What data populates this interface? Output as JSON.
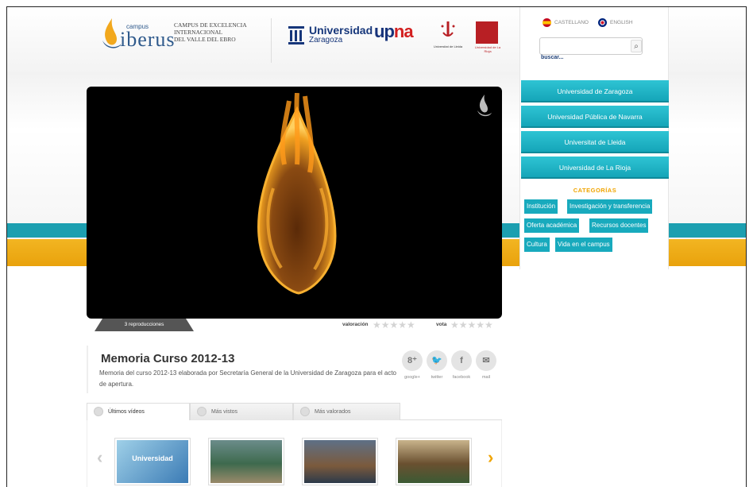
{
  "header": {
    "campus_small": "campus",
    "brand": "iberus",
    "campus_line1": "Campus de Excelencia",
    "campus_line2": "Internacional",
    "campus_line3": "del Valle del Ebro",
    "uz_title": "Universidad",
    "uz_sub": "Zaragoza",
    "upna_main": "up",
    "upna_accent": "na",
    "lleida_caption": "Universitat de Lleida",
    "rioja_caption": "Universidad de La Rioja"
  },
  "sidebar": {
    "lang_es": "Castellano",
    "lang_en": "English",
    "search_value": "",
    "search_label": "buscar...",
    "universities": [
      "Universidad de Zaragoza",
      "Universidad Pública de Navarra",
      "Universitat de Lleida",
      "Universidad de La Rioja"
    ],
    "categories_title": "CATEGORÍAS",
    "categories": [
      "Institución",
      "Investigación y transferencia",
      "Oferta académica",
      "Recursos docentes",
      "Cultura",
      "Vida en el campus"
    ]
  },
  "video": {
    "plays": "3 reproducciones",
    "rating_label": "valoración",
    "vote_label": "vota",
    "stars": "★★★★★",
    "title": "Memoria Curso 2012-13",
    "description": "Memoria del curso 2012-13 elaborada por Secretaría General de la Universidad de Zaragoza para el acto de apertura."
  },
  "social": [
    {
      "icon": "8⁺",
      "label": "google+"
    },
    {
      "icon": "🐦",
      "label": "twitter"
    },
    {
      "icon": "f",
      "label": "facebook"
    },
    {
      "icon": "✉",
      "label": "mail"
    }
  ],
  "tabs": [
    "Últimos vídeos",
    "Más vistos",
    "Más valorados"
  ],
  "carousel": {
    "prev": "‹",
    "next": "›",
    "first_thumb_text": "Universidad"
  },
  "colors": {
    "teal": "#18aabd",
    "yellow": "#f2b522",
    "accent_orange": "#f0a400"
  }
}
